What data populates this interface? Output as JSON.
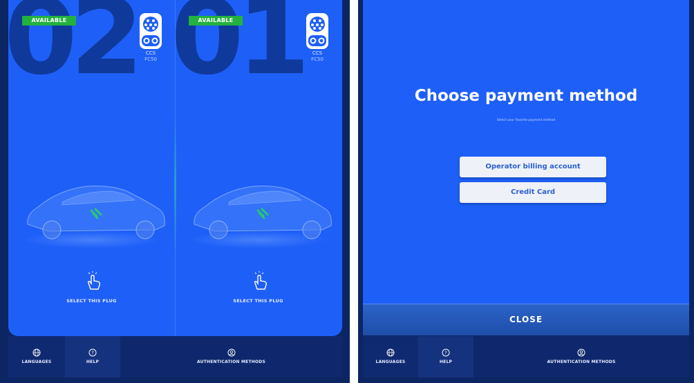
{
  "left_screen": {
    "plugs": [
      {
        "number": "02",
        "status": "AVAILABLE",
        "connector": "CCS",
        "power": "FC50",
        "action": "SELECT THIS PLUG"
      },
      {
        "number": "01",
        "status": "AVAILABLE",
        "connector": "CCS",
        "power": "FC50",
        "action": "SELECT THIS PLUG"
      }
    ],
    "nav": {
      "languages": "LANGUAGES",
      "help": "HELP",
      "auth": "AUTHENTICATION METHODS"
    }
  },
  "right_screen": {
    "title": "Choose payment method",
    "subtitle": "Select your favorite payment method",
    "options": [
      "Operator billing account",
      "Credit Card"
    ],
    "close_label": "CLOSE",
    "nav": {
      "languages": "LANGUAGES",
      "help": "HELP",
      "auth": "AUTHENTICATION METHODS"
    }
  },
  "colors": {
    "panel_blue": "#1e5ff8",
    "dark_navy": "#0c2563",
    "available_green": "#23b13f"
  }
}
